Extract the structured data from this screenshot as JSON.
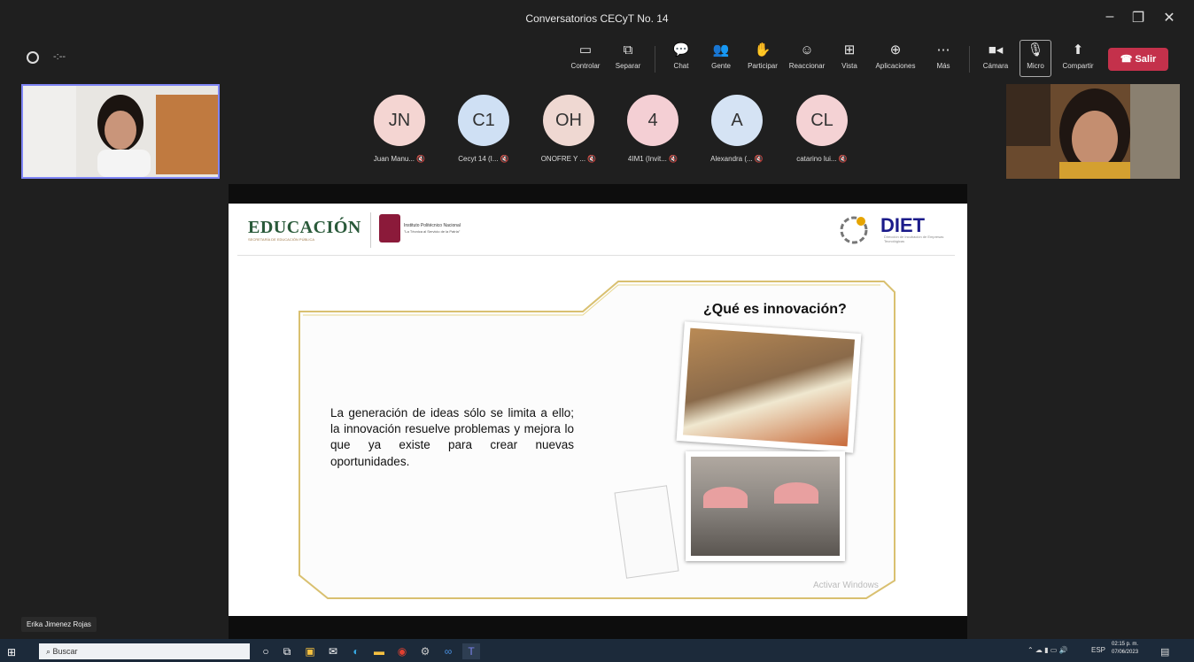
{
  "window": {
    "title": "Conversatorios CECyT No. 14",
    "minimize": "–",
    "maximize": "❐",
    "close": "✕"
  },
  "meeting": {
    "timer": "-:--"
  },
  "toolbar": {
    "buttons": [
      {
        "label": "Controlar",
        "icon": "control-icon"
      },
      {
        "label": "Separar",
        "icon": "popout-icon"
      },
      {
        "label": "Chat",
        "icon": "chat-icon"
      },
      {
        "label": "Gente",
        "icon": "people-icon"
      },
      {
        "label": "Participar",
        "icon": "raise-hand-icon"
      },
      {
        "label": "Reaccionar",
        "icon": "smile-icon"
      },
      {
        "label": "Vista",
        "icon": "grid-icon"
      },
      {
        "label": "Aplicaciones",
        "icon": "add-icon"
      },
      {
        "label": "Más",
        "icon": "more-icon"
      },
      {
        "label": "Cámara",
        "icon": "camera-icon"
      },
      {
        "label": "Micro",
        "icon": "mic-off-icon"
      },
      {
        "label": "Compartir",
        "icon": "share-icon"
      }
    ],
    "leave_label": "Salir",
    "leave_color": "#c4314b"
  },
  "participants": [
    {
      "initials": "JN",
      "name": "Juan Manu...",
      "color": "#f4d5d2"
    },
    {
      "initials": "C1",
      "name": "Cecyt 14 (I...",
      "color": "#cfe0f4"
    },
    {
      "initials": "OH",
      "name": "ONOFRE Y ...",
      "color": "#efd8d2"
    },
    {
      "initials": "4",
      "name": "4IM1 (Invit...",
      "color": "#f4cfd4"
    },
    {
      "initials": "A",
      "name": "Alexandra (...",
      "color": "#d5e3f4"
    },
    {
      "initials": "CL",
      "name": "catarino lui...",
      "color": "#f4d2d4"
    }
  ],
  "video_left_name": "Erika Jimenez Rojas",
  "slide": {
    "brand": "EDUCACIÓN",
    "brand_sub": "SECRETARÍA DE EDUCACIÓN PÚBLICA",
    "institute": "Instituto Politécnico Nacional",
    "institute_slogan": "\"La Técnica al Servicio de la Patria\"",
    "diet": "DIET",
    "diet_sub": "Dirección de Incubación de Empresas Tecnológicas",
    "question": "¿Qué es innovación?",
    "body": "La generación de ideas sólo se limita a ello; la innovación resuelve problemas y mejora lo que ya existe para crear nuevas oportunidades.",
    "watermark": "Activar Windows"
  },
  "taskbar": {
    "search_placeholder": "Buscar",
    "tray_lang": "ESP",
    "time": "02:15 p. m.",
    "date": "07/06/2023"
  }
}
